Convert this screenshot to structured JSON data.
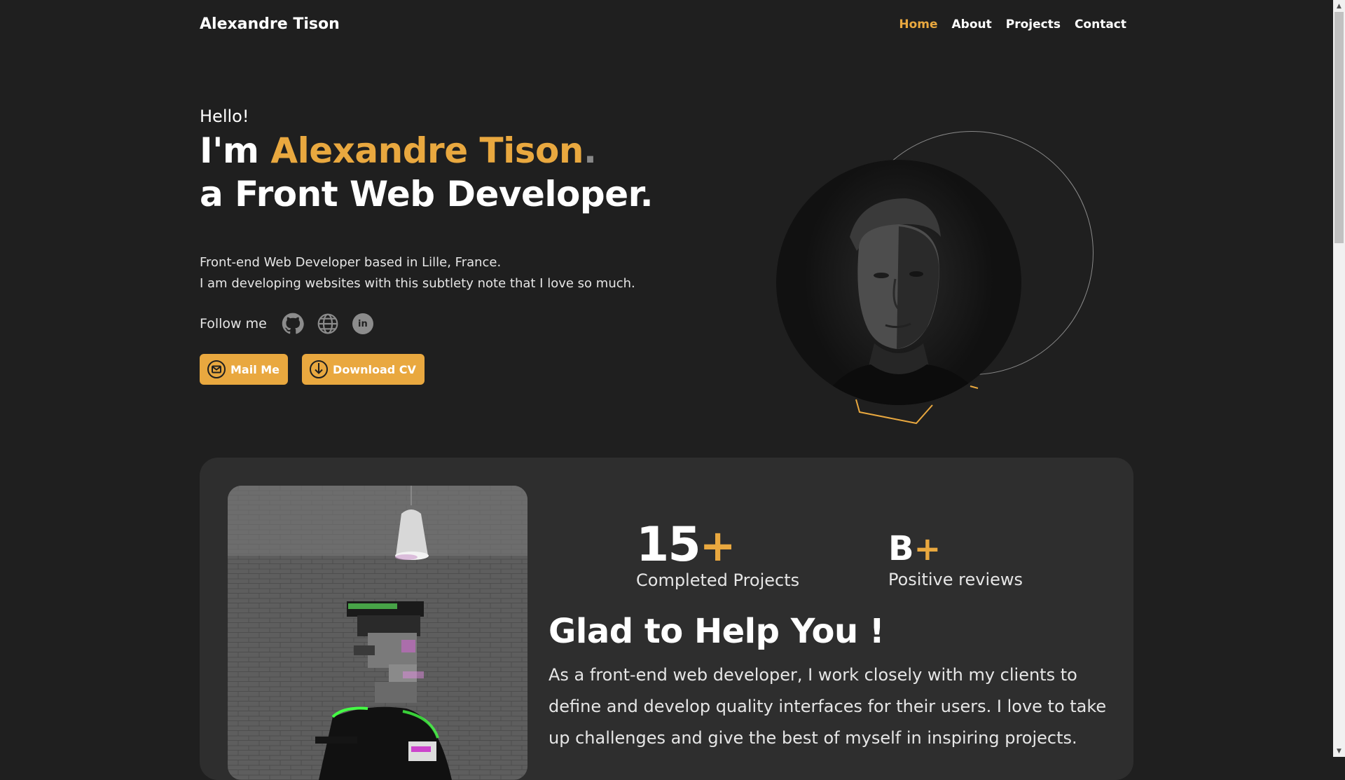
{
  "nav": {
    "logo": "Alexandre Tison",
    "links": [
      {
        "label": "Home",
        "active": true
      },
      {
        "label": "About",
        "active": false
      },
      {
        "label": "Projects",
        "active": false
      },
      {
        "label": "Contact",
        "active": false
      }
    ]
  },
  "hero": {
    "hello": "Hello!",
    "im": "I'm ",
    "name": "Alexandre Tison",
    "dot": ".",
    "role": "a Front Web Developer.",
    "desc_line1": "Front-end Web Developer based in Lille, France.",
    "desc_line2": "I am developing websites with this subtlety note that I love so much.",
    "follow_label": "Follow me",
    "socials": [
      "github-icon",
      "globe-icon",
      "linkedin-icon"
    ],
    "linkedin_text": "in",
    "mail_label": "Mail Me",
    "cv_label": "Download CV"
  },
  "stats": [
    {
      "value": "15",
      "suffix": "+",
      "label": "Completed Projects"
    },
    {
      "value": "B",
      "suffix": "+",
      "label": "Positive reviews"
    }
  ],
  "about": {
    "title": "Glad to Help You !",
    "paragraph": "As a front-end web developer, I work closely with my clients to define and develop quality interfaces for their users. I love to take up challenges and give the best of myself in inspiring projects."
  },
  "colors": {
    "background": "#1f1f1f",
    "card": "#2e2e2e",
    "accent": "#e9a83f"
  }
}
